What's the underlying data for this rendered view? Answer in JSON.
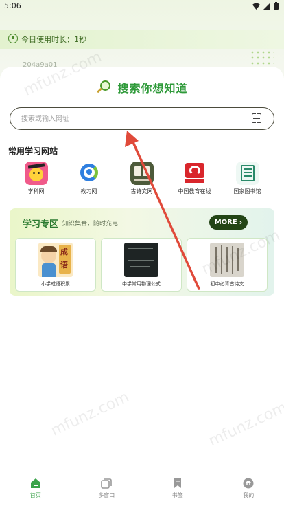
{
  "status_bar": {
    "time": "5:06"
  },
  "usage_bar": {
    "text": "今日使用时长：1秒"
  },
  "id_text": "204a9a01",
  "search": {
    "title": "搜索你想知道",
    "placeholder": "搜索或输入网址"
  },
  "sites_section": {
    "title": "常用学习网站",
    "items": [
      {
        "label": "学科网",
        "icon": "graduation-chick-logo"
      },
      {
        "label": "教习网",
        "icon": "blue-figure-logo"
      },
      {
        "label": "古诗文网",
        "icon": "book-logo"
      },
      {
        "label": "中国教育在线",
        "icon": "red-2-logo"
      },
      {
        "label": "国家图书馆",
        "icon": "library-logo"
      }
    ]
  },
  "study_zone": {
    "title": "学习专区",
    "subtitle": "知识集合，随时充电",
    "more_label": "MORE",
    "cards": [
      {
        "caption": "小学成语积累",
        "badge_top": "成",
        "badge_bottom": "语"
      },
      {
        "caption": "中学常用物理公式"
      },
      {
        "caption": "初中必背古诗文"
      }
    ]
  },
  "watermark": "mfunz.com",
  "tabbar": {
    "items": [
      {
        "label": "首页",
        "active": true
      },
      {
        "label": "多窗口",
        "active": false
      },
      {
        "label": "书签",
        "active": false
      },
      {
        "label": "我的",
        "active": false
      }
    ]
  },
  "colors": {
    "accent": "#3aa34a",
    "arrow": "#e04a3a",
    "more_bg": "#234516"
  }
}
